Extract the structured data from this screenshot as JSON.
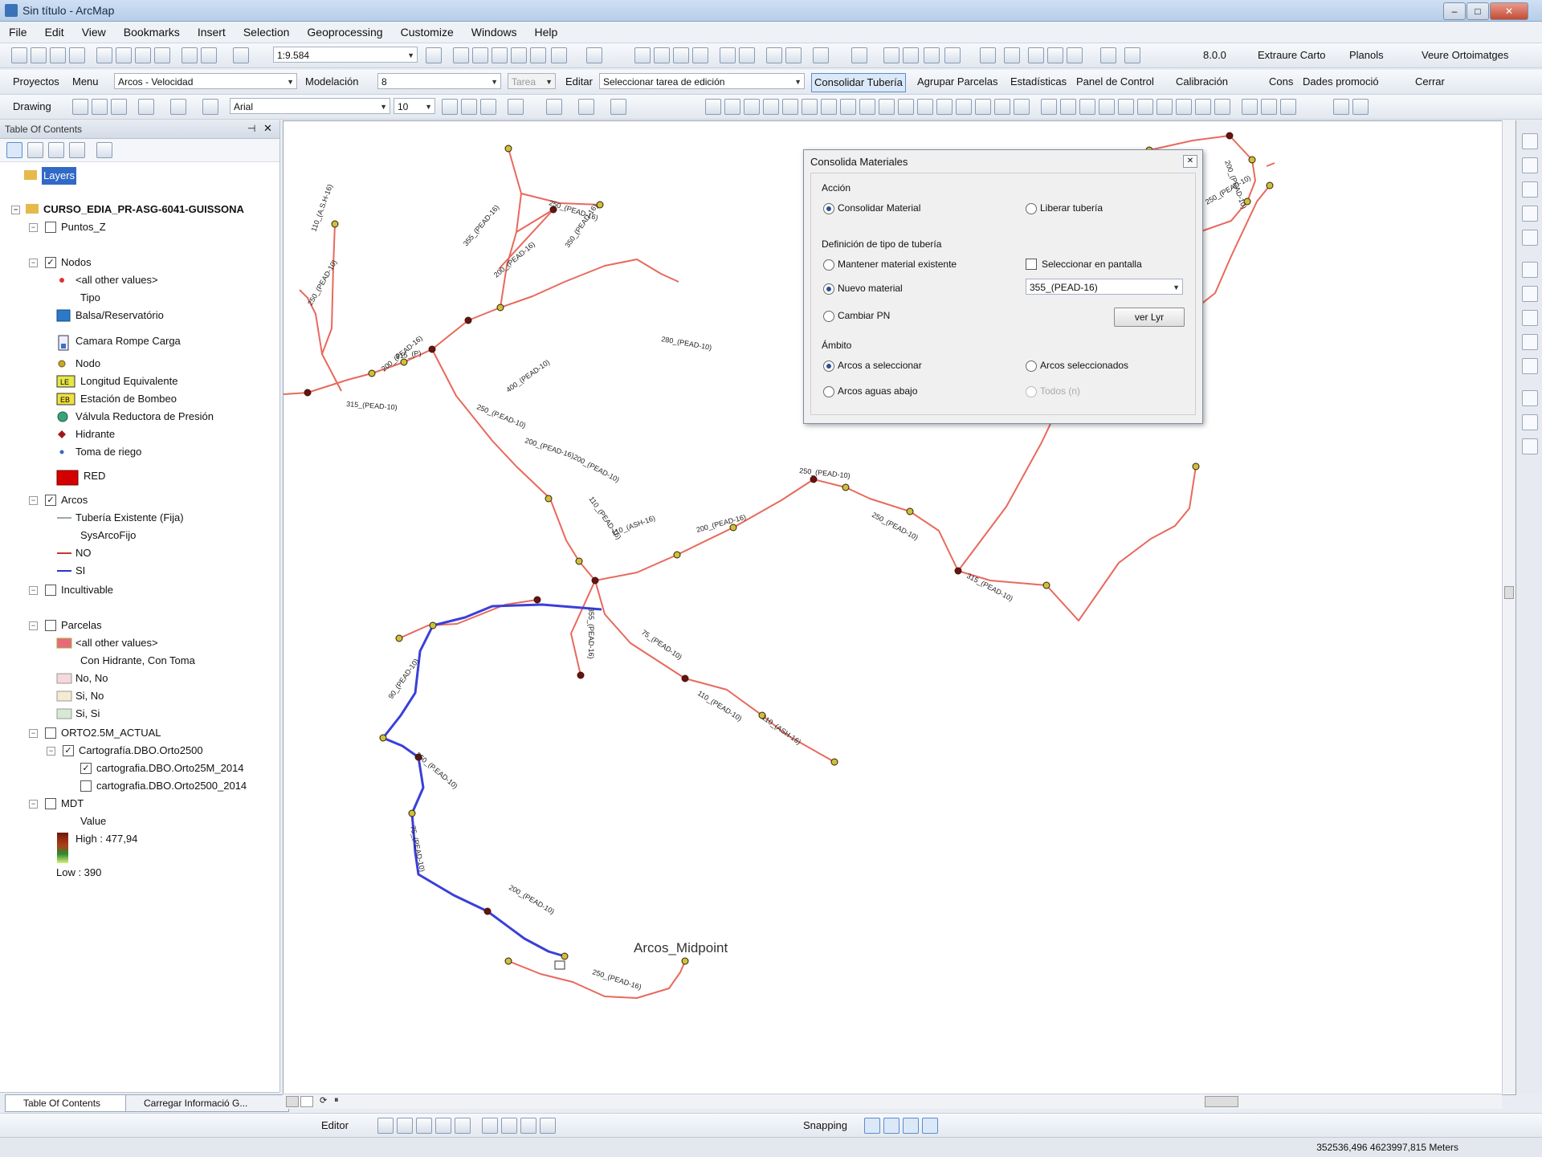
{
  "window": {
    "title": "Sin título - ArcMap"
  },
  "menu": [
    "File",
    "Edit",
    "View",
    "Bookmarks",
    "Insert",
    "Selection",
    "Geoprocessing",
    "Customize",
    "Windows",
    "Help"
  ],
  "toolbar1": {
    "scale": "1:9.584",
    "gpx_label": "8.0.0",
    "extract_label": "Extraure Carto",
    "planols_label": "Planols",
    "visor_label": "Veure Ortoimatges"
  },
  "toolbar2": {
    "projects": "Proyectos",
    "menu": "Menu",
    "arcos_combo": "Arcos - Velocidad",
    "modelacion": "Modelación",
    "modelacion_value": "8",
    "tarea": "Tarea",
    "editar": "Editar",
    "editar_combo": "Seleccionar tarea de edición",
    "consolidar": "Consolidar Tubería",
    "agrupar": "Agrupar Parcelas",
    "estadisticas": "Estadísticas",
    "panel": "Panel de Control",
    "calibracion": "Calibración",
    "cons": "Cons",
    "datos": "Dades promoció",
    "cerrar": "Cerrar"
  },
  "toolbar3": {
    "drawing": "Drawing",
    "font": "Arial",
    "size": "10"
  },
  "toc": {
    "title": "Table Of Contents",
    "root": "Layers",
    "project": "CURSO_EDIA_PR-ASG-6041-GUISSONA",
    "items": [
      {
        "label": "Puntos_Z"
      },
      {
        "label": "Nodos"
      },
      {
        "label": "<all other values>"
      },
      {
        "label": "Tipo"
      },
      {
        "label": "Balsa/Reservatório"
      },
      {
        "label": "Camara Rompe Carga"
      },
      {
        "label": "Nodo"
      },
      {
        "label": "Longitud Equivalente"
      },
      {
        "label": "Estación de Bombeo"
      },
      {
        "label": "Válvula Reductora de Presión"
      },
      {
        "label": "Hidrante"
      },
      {
        "label": "Toma de riego"
      },
      {
        "label": "RED"
      },
      {
        "label": "Arcos"
      },
      {
        "label": "Tubería Existente (Fija)"
      },
      {
        "label": "SysArcoFijo"
      },
      {
        "label": "NO"
      },
      {
        "label": "SI"
      },
      {
        "label": "Incultivable"
      },
      {
        "label": "Parcelas"
      },
      {
        "label": "<all other values>"
      },
      {
        "label": "Con Hidrante, Con Toma"
      },
      {
        "label": "No, No"
      },
      {
        "label": "Si, No"
      },
      {
        "label": "Si, Si"
      },
      {
        "label": "ORTO2.5M_ACTUAL"
      },
      {
        "label": "Cartografía.DBO.Orto2500"
      },
      {
        "label": "cartografia.DBO.Orto25M_2014"
      },
      {
        "label": "cartografia.DBO.Orto2500_2014"
      },
      {
        "label": "MDT"
      },
      {
        "label": "Value"
      },
      {
        "label": "High : 477,94"
      },
      {
        "label": "Low : 390"
      }
    ]
  },
  "dialog": {
    "title": "Consolida Materiales",
    "accion_label": "Acción",
    "opt_consolidar": "Consolidar Material",
    "opt_liberar": "Liberar tubería",
    "definicion_label": "Definición de tipo de tubería",
    "opt_mantener": "Mantener material existente",
    "chk_seleccionar": "Seleccionar en pantalla",
    "opt_nuevo": "Nuevo material",
    "material_value": "355_(PEAD-16)",
    "opt_cambiar": "Cambiar PN",
    "ver_button": "ver Lyr",
    "ambito_label": "Ámbito",
    "opt_arcos_sel": "Arcos a seleccionar",
    "opt_arcos_seleccionados": "Arcos seleccionados",
    "opt_aguas": "Arcos aguas abajo",
    "opt_todos": "Todos (n)"
  },
  "map": {
    "midpoint_label": "Arcos_Midpoint",
    "colors": {
      "red_pipe": "#e8695c",
      "blue_pipe": "#3a3fd9",
      "node": "#6b1111",
      "node_yellow": "#c9c23a"
    },
    "arc_labels": [
      "250_(PEAD-16)",
      "280_(PEAD-10)",
      "350_(PEAD-16)",
      "355_(PEAD-16)",
      "200_(PEAD-16)",
      "315_(PEAD-10)",
      "250_(PEAD-10)",
      "110_(A.S.H-16)",
      "400_(PEAD-10)",
      "200_(PEAD-16)",
      "315_(P)",
      "250_(P.EAD-10)",
      "200_(PEAD-16)",
      "200_(PEAD-10)",
      "110_(PEAD-16)",
      "110_(ASH-16)",
      "200_(PEAD-16)",
      "250_(PEAD-10)",
      "250_(PEAD-10)",
      "315_(PEAD-10)",
      "355_(PEAD-10)",
      "200_(PEAD-16)",
      "250_(PEAD-10)",
      "200_(PEAD-10)",
      "315_(PEAD-16)",
      "355_(PEAD-16)",
      "75_(PEAD-10)",
      "110_(PEAD-10)",
      "110_(ASH-16)",
      "90_(PEAD-10)",
      "250_(P.EAD-10)",
      "75_(PEAD-10)",
      "200_(PEAD-10)",
      "250_(PEAD-16)"
    ]
  },
  "bottom": {
    "tab_toc": "Table Of Contents",
    "tab_cargar": "Carregar Informació G...",
    "editor": "Editor",
    "snapping": "Snapping",
    "coords": "352536,496  4623997,815 Meters"
  }
}
